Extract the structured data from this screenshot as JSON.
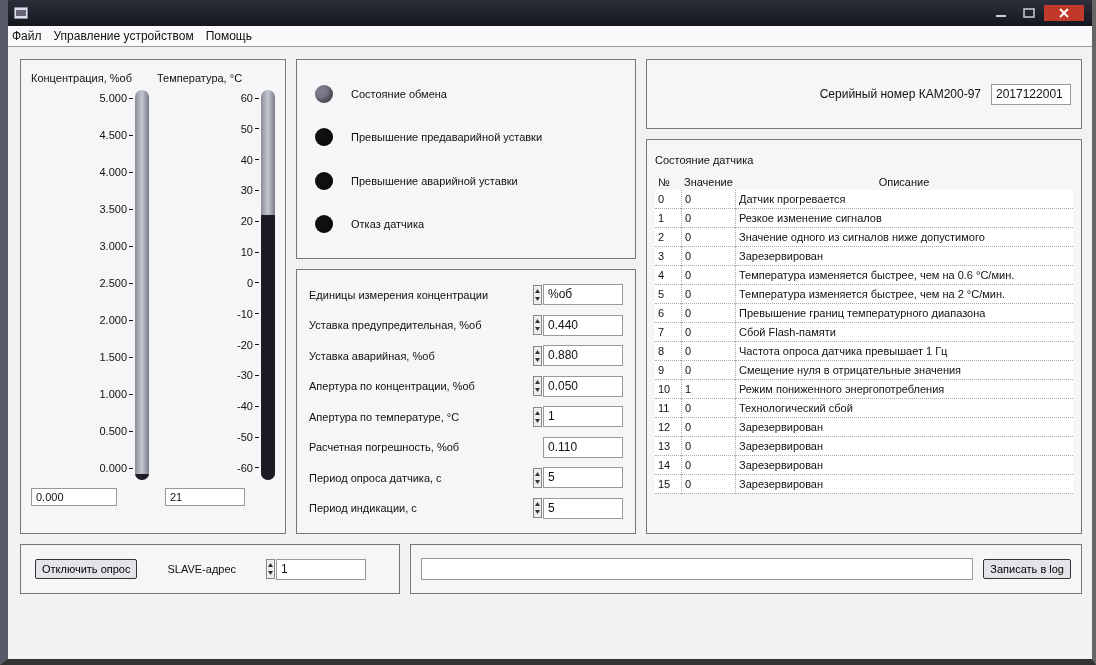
{
  "menu": [
    "Файл",
    "Управление устройством",
    "Помощь"
  ],
  "gauges": [
    {
      "label": "Концентрация, %об",
      "ticks": [
        "5.000",
        "4.500",
        "4.000",
        "3.500",
        "3.000",
        "2.500",
        "2.000",
        "1.500",
        "1.000",
        "0.500",
        "0.000"
      ],
      "level": 0,
      "value": "0.000"
    },
    {
      "label": "Температура, °С",
      "ticks": [
        "60",
        "50",
        "40",
        "30",
        "20",
        "10",
        "0",
        "-10",
        "-20",
        "-30",
        "-40",
        "-50",
        "-60"
      ],
      "level": 0.675,
      "value": "21"
    }
  ],
  "indicators": [
    {
      "label": "Состояние обмена",
      "color": "#7a7a8a"
    },
    {
      "label": "Превышение предаварийной уставки",
      "color": "#111111"
    },
    {
      "label": "Превышение аварийной уставки",
      "color": "#111111"
    },
    {
      "label": "Отказ датчика",
      "color": "#111111"
    }
  ],
  "settings": [
    {
      "label": "Единицы измерения концентрации",
      "value": "%об",
      "kind": "spin"
    },
    {
      "label": "Уставка предупредительная, %об",
      "value": "0.440",
      "kind": "spin"
    },
    {
      "label": "Уставка аварийная, %об",
      "value": "0.880",
      "kind": "spin"
    },
    {
      "label": "Апертура по концентрации, %об",
      "value": "0.050",
      "kind": "spin"
    },
    {
      "label": "Апертура по температуре, °С",
      "value": "1",
      "kind": "spin"
    },
    {
      "label": "Расчетная погрешность, %об",
      "value": "0.110",
      "kind": "plain"
    },
    {
      "label": "Период опроса датчика, с",
      "value": "5",
      "kind": "spin"
    },
    {
      "label": "Период индикации, с",
      "value": "5",
      "kind": "spin"
    }
  ],
  "serial": {
    "label": "Серийный номер КАМ200-97",
    "value": "2017122001"
  },
  "status_table": {
    "title": "Состояние датчика",
    "columns": [
      "№",
      "Значение",
      "Описание"
    ],
    "rows": [
      [
        "0",
        "0",
        "Датчик прогревается"
      ],
      [
        "1",
        "0",
        "Резкое изменение сигналов"
      ],
      [
        "2",
        "0",
        "Значение одного из сигналов ниже допустимого"
      ],
      [
        "3",
        "0",
        "Зарезервирован"
      ],
      [
        "4",
        "0",
        "Температура изменяется быстрее, чем на 0.6 °С/мин."
      ],
      [
        "5",
        "0",
        "Температура изменяется быстрее, чем на 2 °С/мин."
      ],
      [
        "6",
        "0",
        "Превышение границ температурного диапазона"
      ],
      [
        "7",
        "0",
        "Сбой  Flash-памяти"
      ],
      [
        "8",
        "0",
        "Частота опроса датчика превышает 1 Гц"
      ],
      [
        "9",
        "0",
        "Смещение нуля в отрицательные значения"
      ],
      [
        "10",
        "1",
        "Режим пониженного энергопотребления"
      ],
      [
        "11",
        "0",
        "Технологический сбой"
      ],
      [
        "12",
        "0",
        "Зарезервирован"
      ],
      [
        "13",
        "0",
        "Зарезервирован"
      ],
      [
        "14",
        "0",
        "Зарезервирован"
      ],
      [
        "15",
        "0",
        "Зарезервирован"
      ]
    ]
  },
  "poll_button": "Отключить опрос",
  "slave": {
    "label": "SLAVE-адрес",
    "value": "1"
  },
  "log_button": "Записать в log"
}
